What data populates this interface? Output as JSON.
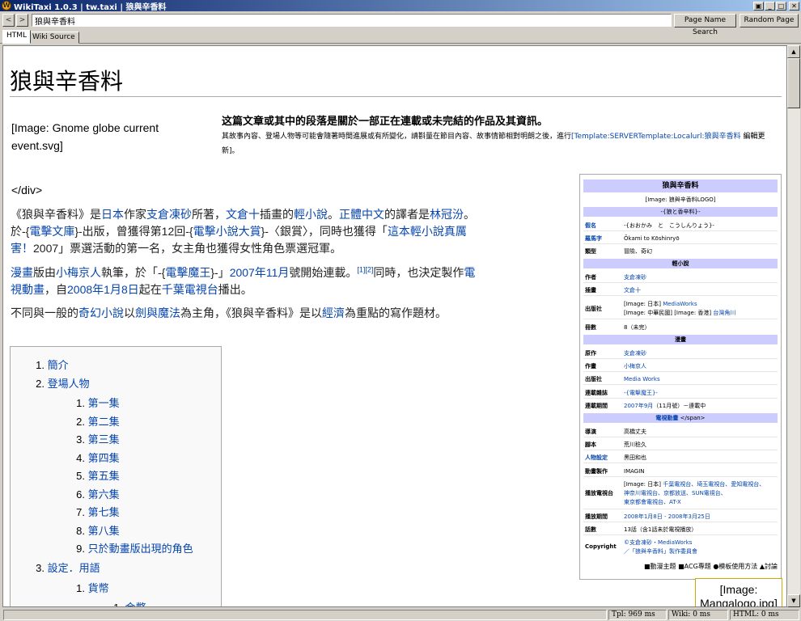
{
  "window": {
    "title": "WikiTaxi 1.0.3 | tw.taxi | 狼與辛香料",
    "icon": "wikitaxi-app-icon"
  },
  "toolbar": {
    "back_label": "<",
    "forward_label": ">",
    "address_value": "狼與辛香料",
    "page_name_search": "Page Name Search",
    "random_page": "Random Page"
  },
  "tabs": [
    {
      "label": "HTML",
      "active": true
    },
    {
      "label": "Wiki Source",
      "active": false
    }
  ],
  "article": {
    "title": "狼與辛香料",
    "image_caption": "[Image: Gnome globe current event.svg]",
    "notice_title": "这篇文章或其中的段落是關於一部正在連載或未完結的作品及其資訊。",
    "notice_text_1": "其故事內容、登場人物等可能會隨著時間進展或有所變化，請斟量在節目內容、故事情節相對明朗之後，進行",
    "notice_link": "[Template:SERVERTemplate:Localurl:狼與辛香料",
    "notice_text_2": " 編輯更新]。",
    "close_div": "</div>",
    "p1": {
      "t1": "《狼與辛香料》是",
      "l1": "日本",
      "t2": "作家",
      "l2": "支倉凍砂",
      "t3": "所著，",
      "l3": "文倉十",
      "t4": "插畫的",
      "l4": "輕小說",
      "t5": "。",
      "l5": "正體中文",
      "t6": "的譯者是",
      "l6": "林冠汾",
      "t7": "。於-{",
      "l7": "電擊文庫",
      "t8": "}-出版，曾獲得第12回-{",
      "l8": "電擊小說大賞",
      "t9": "}-〈銀賞〉，同時也獲得「",
      "l9": "這本輕小說真厲害！",
      "t10": "2007」票選活動的第一名，女主角也獲得女性角色票選冠軍。"
    },
    "p2": {
      "l1": "漫畫",
      "t1": "版由",
      "l2": "小梅京人",
      "t2": "執筆，於「-{",
      "l3": "電擊魔王",
      "t3": "}-」",
      "l4": "2007年",
      "l5": "11月",
      "t4": "號開始連載。",
      "ref": "[1][2]",
      "t5": "同時，也決定製作",
      "l6": "電視動畫",
      "t6": "，自",
      "l7": "2008年",
      "l8": "1月8日",
      "t7": "起在",
      "l9": "千葉電視台",
      "t8": "播出。"
    },
    "p3": {
      "t1": "不同與一般的",
      "l1": "奇幻小說",
      "t2": "以",
      "l2": "劍與魔法",
      "t3": "為主角，《狼與辛香料》是以",
      "l3": "經濟",
      "t4": "為重點的寫作題材。"
    }
  },
  "toc": [
    {
      "num": "1.",
      "label": "簡介",
      "level": 1
    },
    {
      "num": "2.",
      "label": "登場人物",
      "level": 1
    },
    {
      "num": "1.",
      "label": "第一集",
      "level": 2
    },
    {
      "num": "2.",
      "label": "第二集",
      "level": 2
    },
    {
      "num": "3.",
      "label": "第三集",
      "level": 2
    },
    {
      "num": "4.",
      "label": "第四集",
      "level": 2
    },
    {
      "num": "5.",
      "label": "第五集",
      "level": 2
    },
    {
      "num": "6.",
      "label": "第六集",
      "level": 2
    },
    {
      "num": "7.",
      "label": "第七集",
      "level": 2
    },
    {
      "num": "8.",
      "label": "第八集",
      "level": 2
    },
    {
      "num": "9.",
      "label": "只於動畫版出現的角色",
      "level": 2
    },
    {
      "num": "3.",
      "label": "設定．用語",
      "level": 1
    },
    {
      "num": "1.",
      "label": "貨幣",
      "level": 2
    },
    {
      "num": "1.",
      "label": "金幣",
      "level": 3
    }
  ],
  "infobox": {
    "title": "狼與辛香料",
    "logo": "[Image: 狼與辛香料LOGO]",
    "subtitle": "-{狼と香辛料}-",
    "original_name_k": "假名",
    "original_name_v": "-{おおかみ　と　こうしんりょう}-",
    "romaji_k": "羅馬字",
    "romaji_v": "Ōkami to Kōshinryō",
    "genre_k": "類型",
    "genre_v": "冒險、奇幻",
    "novel_hdr": "輕小說",
    "author_k": "作者",
    "author_v": "支倉凍砂",
    "illus_k": "插畫",
    "illus_v": "文倉十",
    "pub_k": "出版社",
    "pub_v1": "[Image: 日本] ",
    "pub_v1_link": "MediaWorks",
    "pub_v2": "[Image: 中華民國] [Image: 香港] ",
    "pub_v2_link": "台灣角川",
    "vols_k": "冊數",
    "vols_v": "8（未完）",
    "manga_hdr": "漫畫",
    "orig_k": "原作",
    "orig_v": "支倉凍砂",
    "draw_k": "作畫",
    "draw_v": "小梅京人",
    "mpub_k": "出版社",
    "mpub_v": "Media Works",
    "mag_k": "連載雜誌",
    "mag_v": "-{電擊魔王}-",
    "period_k": "連載期間",
    "period_v_link": "2007年9月",
    "period_v": "（11月號）－連載中",
    "anime_hdr": "電視動畫",
    "anime_hdr_tail": " </span>",
    "dir_k": "導演",
    "dir_v": "高橋丈夫",
    "script_k": "腳本",
    "script_v": "荒川稔久",
    "char_k": "人物設定",
    "char_v": "黑田和也",
    "prod_k": "動畫製作",
    "prod_v": "IMAGIN",
    "bcast_k": "播放電視台",
    "bcast_v1": "[Image: 日本] ",
    "bcast_v1_link": "千葉電視台、埼玉電視台、愛知電視台、",
    "bcast_v2_link": "神奈川電視台、京都放送、SUN電視台、",
    "bcast_v3_link": "東京都會電視台、AT-X",
    "air_k": "播放期間",
    "air_v": "2008年1月8日 - 2008年3月25日",
    "eps_k": "話數",
    "eps_v": "13話（含1話未於電視播放）",
    "copy_k": "Copyright",
    "copy_v1": "©支倉凍砂・MediaWorks",
    "copy_v2": "／「狼與辛香料」製作委員會",
    "foot": "■動漫主題 ■ACG專題 ●模板使用方法 ▲討論"
  },
  "side_image": "[Image: Mangalogo.jpg]",
  "status": {
    "main": "",
    "tpl": "Tpl: 969 ms",
    "wiki": "Wiki: 0 ms",
    "html": "HTML: 0 ms"
  }
}
